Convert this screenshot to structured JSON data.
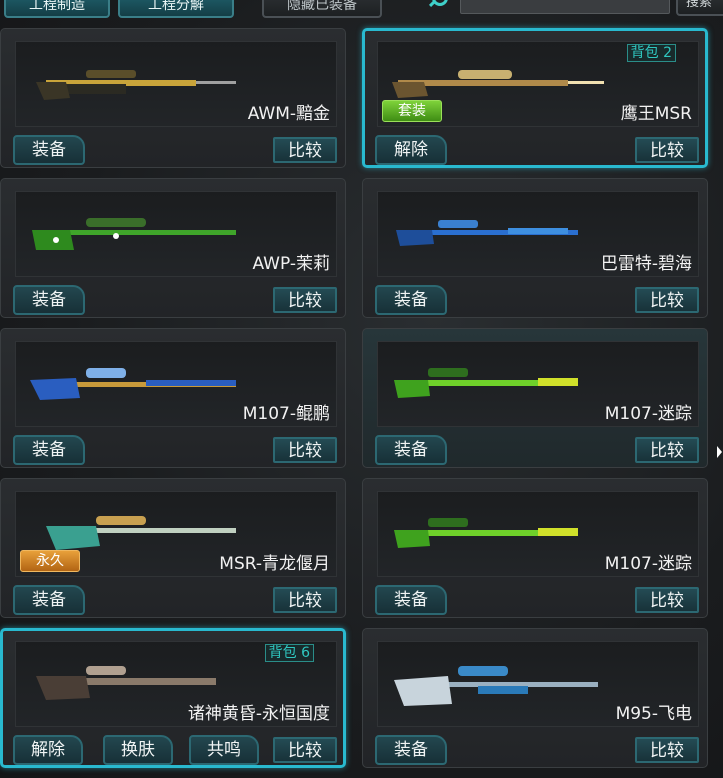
{
  "toolbar": {
    "craft_label": "工程制造",
    "decompose_label": "工程分解",
    "hide_equipped_label": "隐藏已装备",
    "search_placeholder": "",
    "search_label": "搜索"
  },
  "colors": {
    "accent": "#29b9cf",
    "set_badge": "#5bb22a",
    "permanent_badge": "#d9892a"
  },
  "cards": [
    {
      "name": "AWM-黯金",
      "primary": "装备",
      "compare": "比较",
      "selected": false
    },
    {
      "name": "鹰王MSR",
      "primary": "解除",
      "compare": "比较",
      "selected": true,
      "bag": "背包 2",
      "badge": "套装"
    },
    {
      "name": "AWP-茉莉",
      "primary": "装备",
      "compare": "比较",
      "selected": false
    },
    {
      "name": "巴雷特-碧海",
      "primary": "装备",
      "compare": "比较",
      "selected": false
    },
    {
      "name": "M107-鲲鹏",
      "primary": "装备",
      "compare": "比较",
      "selected": false
    },
    {
      "name": "M107-迷踪",
      "primary": "装备",
      "compare": "比较",
      "selected": false
    },
    {
      "name": "MSR-青龙偃月",
      "primary": "装备",
      "compare": "比较",
      "selected": false,
      "badge": "永久"
    },
    {
      "name": "M107-迷踪",
      "primary": "装备",
      "compare": "比较",
      "selected": false
    },
    {
      "name": "诸神黄昏-永恒国度",
      "primary": "解除",
      "skin": "换肤",
      "resonate": "共鸣",
      "compare": "比较",
      "selected": true,
      "bag": "背包 6"
    },
    {
      "name": "M95-飞电",
      "primary": "装备",
      "compare": "比较",
      "selected": false
    }
  ]
}
